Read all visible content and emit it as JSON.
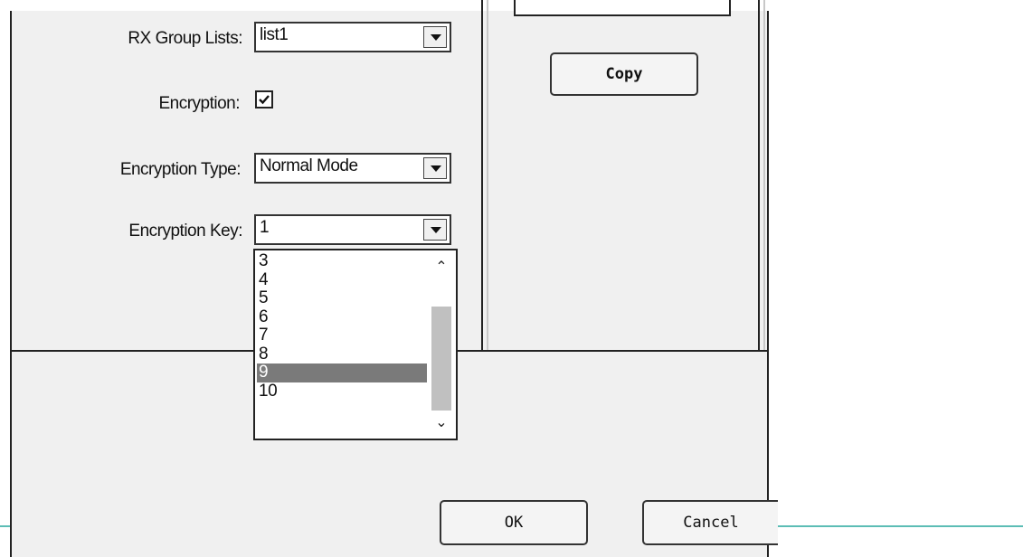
{
  "form": {
    "rx_group_lists_label": "RX Group Lists:",
    "rx_group_lists_value": "list1",
    "encryption_label": "Encryption:",
    "encryption_checked": true,
    "encryption_type_label": "Encryption Type:",
    "encryption_type_value": "Normal Mode",
    "encryption_key_label": "Encryption Key:",
    "encryption_key_value": "1"
  },
  "encryption_key_options": [
    "3",
    "4",
    "5",
    "6",
    "7",
    "8",
    "9",
    "10"
  ],
  "encryption_key_highlighted": "9",
  "buttons": {
    "copy": "Copy",
    "ok": "OK",
    "cancel": "Cancel"
  },
  "colors": {
    "dialog_bg": "#f0f0f0",
    "highlight": "#7a7a7a",
    "accent_line": "#5cbdb5"
  }
}
